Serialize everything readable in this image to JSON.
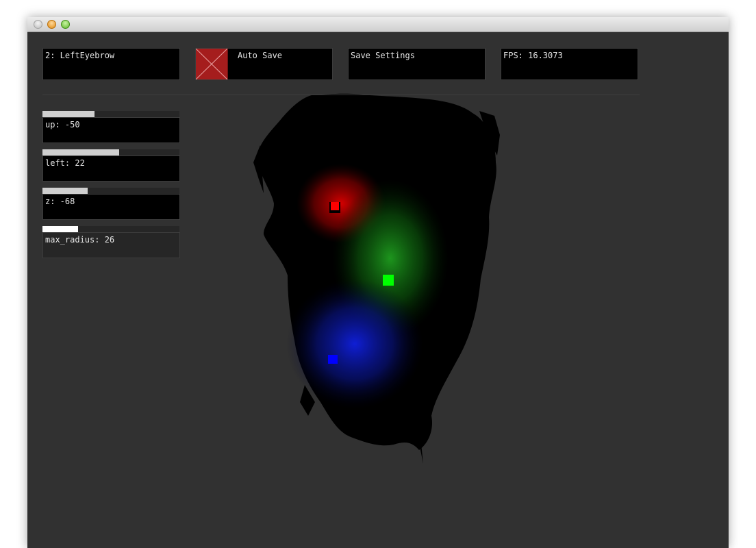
{
  "window": {
    "controls": [
      "close",
      "minimize",
      "maximize"
    ]
  },
  "toolbar": {
    "selected_point": "2: LeftEyebrow",
    "auto_save": {
      "label": "Auto Save",
      "checked": true,
      "color": "#a51d1d"
    },
    "save_settings": "Save Settings",
    "fps": "FPS: 16.3073"
  },
  "sliders": [
    {
      "name": "up",
      "label": "up: -50",
      "fraction": 0.38,
      "active": false
    },
    {
      "name": "left",
      "label": "left: 22",
      "fraction": 0.56,
      "active": false
    },
    {
      "name": "z",
      "label": "z: -68",
      "fraction": 0.33,
      "active": false
    },
    {
      "name": "max_radius",
      "label": "max_radius: 26",
      "fraction": 0.26,
      "active": true
    }
  ],
  "markers": [
    {
      "name": "left-eyebrow",
      "color": "#ff0000"
    },
    {
      "name": "nose",
      "color": "#00ff00"
    },
    {
      "name": "mouth",
      "color": "#0000ff"
    }
  ],
  "colors": {
    "background": "#313131",
    "panel": "#000000",
    "text": "#e6e6e6"
  }
}
